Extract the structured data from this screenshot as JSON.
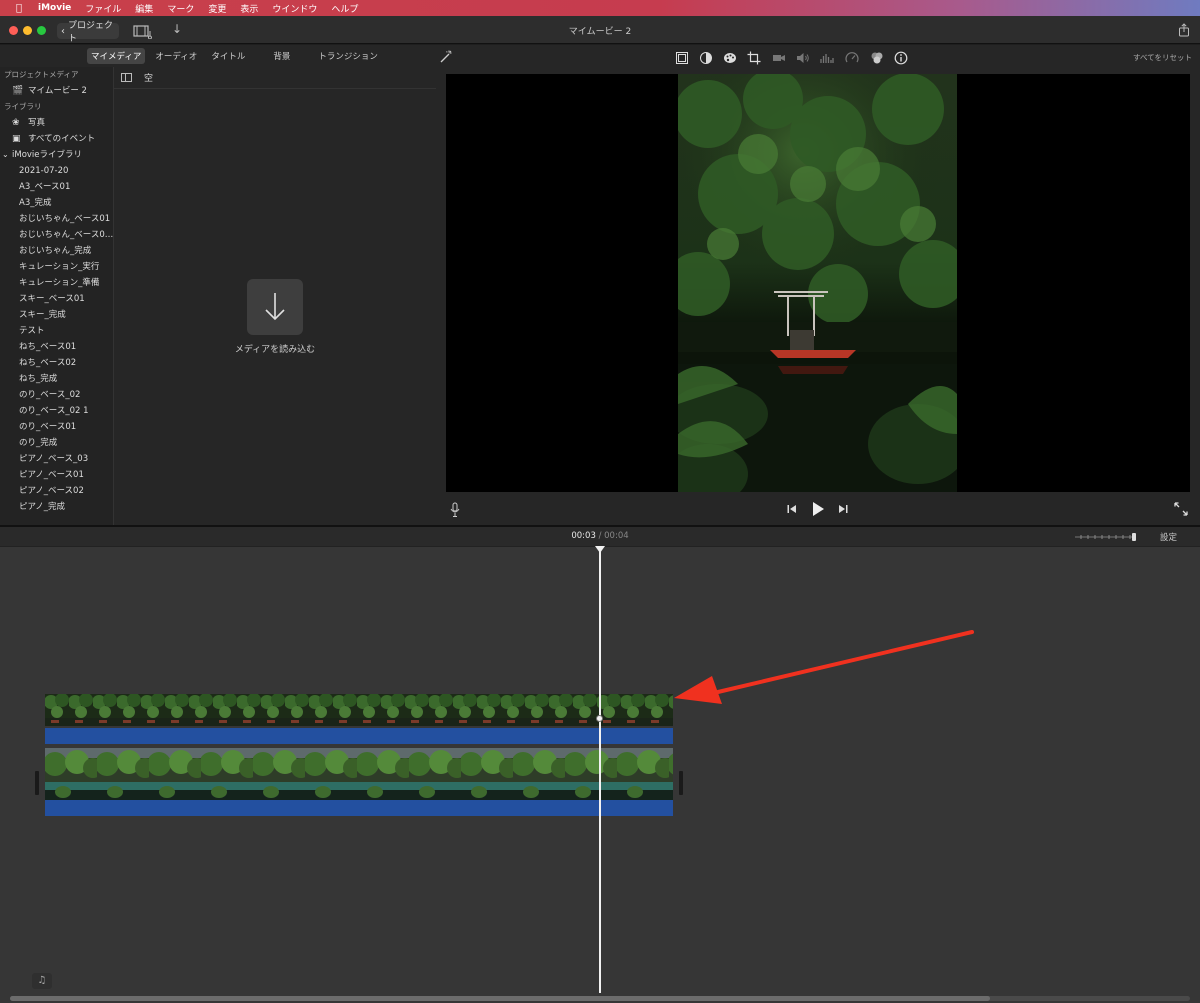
{
  "menubar": {
    "app": "iMovie",
    "items": [
      "ファイル",
      "編集",
      "マーク",
      "変更",
      "表示",
      "ウインドウ",
      "ヘルプ"
    ]
  },
  "window": {
    "title": "マイムービー 2",
    "back_label": "プロジェクト"
  },
  "media_tabs": [
    "マイメディア",
    "オーディオ",
    "タイトル",
    "背景",
    "トランジション"
  ],
  "sidebar": {
    "project_media_header": "プロジェクトメディア",
    "project_item": "マイムービー 2",
    "library_header": "ライブラリ",
    "photos": "写真",
    "all_events": "すべてのイベント",
    "library_name": "iMovieライブラリ",
    "events": [
      "2021-07-20",
      "A3_ベース01",
      "A3_完成",
      "おじいちゃん_ベース01",
      "おじいちゃん_ベース0…",
      "おじいちゃん_完成",
      "キュレーション_実行",
      "キュレーション_準備",
      "スキー_ベース01",
      "スキー_完成",
      "テスト",
      "ねち_ベース01",
      "ねち_ベース02",
      "ねち_完成",
      "のり_ベース_02",
      "のり_ベース_02 1",
      "のり_ベース01",
      "のり_完成",
      "ピアノ_ベース_03",
      "ピアノ_ベース01",
      "ピアノ_ベース02",
      "ピアノ_完成"
    ]
  },
  "browser": {
    "filter_label": "空",
    "import_label": "メディアを読み込む"
  },
  "viewer": {
    "reset_all": "すべてをリセット",
    "icons": [
      "crop-to-fill-icon",
      "color-balance-icon",
      "color-palette-icon",
      "crop-icon",
      "stabilization-icon",
      "volume-icon",
      "noise-reduction-icon",
      "speed-icon",
      "clip-filter-icon",
      "info-icon"
    ]
  },
  "timeline": {
    "current_time": "00:03",
    "separator": "/",
    "total_time": "00:04",
    "settings_label": "設定"
  },
  "colors": {
    "audio_bar": "#2350a0",
    "annotation_arrow": "#f0311f",
    "menubar_gradient_start": "#c8404a",
    "menubar_gradient_end": "#6f7bc0"
  }
}
